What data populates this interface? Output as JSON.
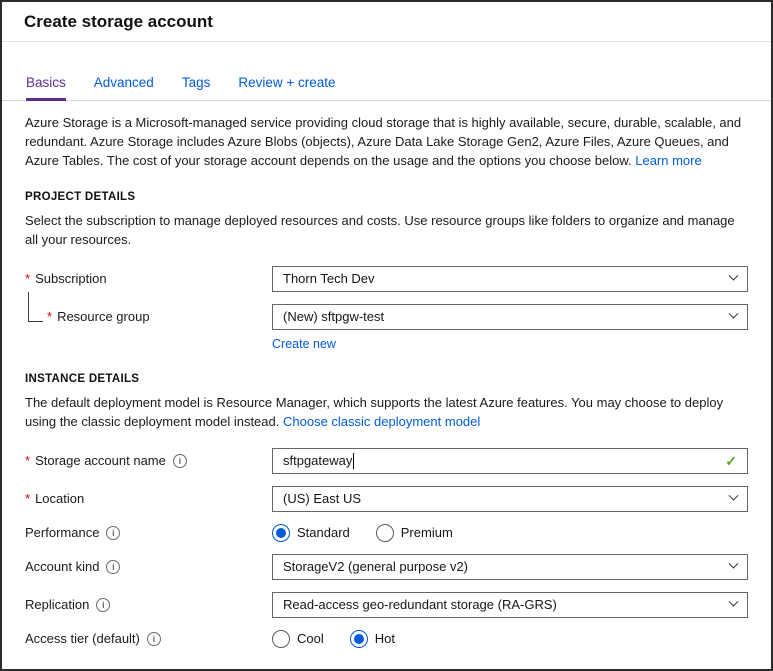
{
  "page": {
    "title": "Create storage account"
  },
  "tabs": [
    {
      "label": "Basics",
      "active": true
    },
    {
      "label": "Advanced",
      "active": false
    },
    {
      "label": "Tags",
      "active": false
    },
    {
      "label": "Review + create",
      "active": false
    }
  ],
  "intro": {
    "text": "Azure Storage is a Microsoft-managed service providing cloud storage that is highly available, secure, durable, scalable, and redundant. Azure Storage includes Azure Blobs (objects), Azure Data Lake Storage Gen2, Azure Files, Azure Queues, and Azure Tables. The cost of your storage account depends on the usage and the options you choose below.",
    "learn_more_label": "Learn more"
  },
  "project_details": {
    "heading": "PROJECT DETAILS",
    "description": "Select the subscription to manage deployed resources and costs. Use resource groups like folders to organize and manage all your resources.",
    "subscription": {
      "label": "Subscription",
      "required": true,
      "value": "Thorn Tech Dev"
    },
    "resource_group": {
      "label": "Resource group",
      "required": true,
      "value": "(New) sftpgw-test",
      "create_new_label": "Create new"
    }
  },
  "instance_details": {
    "heading": "INSTANCE DETAILS",
    "description": "The default deployment model is Resource Manager, which supports the latest Azure features. You may choose to deploy using the classic deployment model instead.",
    "classic_link_label": "Choose classic deployment model",
    "storage_account_name": {
      "label": "Storage account name",
      "required": true,
      "value": "sftpgateway",
      "valid": true
    },
    "location": {
      "label": "Location",
      "required": true,
      "value": "(US) East US"
    },
    "performance": {
      "label": "Performance",
      "options": [
        "Standard",
        "Premium"
      ],
      "selected": "Standard"
    },
    "account_kind": {
      "label": "Account kind",
      "value": "StorageV2 (general purpose v2)"
    },
    "replication": {
      "label": "Replication",
      "value": "Read-access geo-redundant storage (RA-GRS)"
    },
    "access_tier": {
      "label": "Access tier (default)",
      "options": [
        "Cool",
        "Hot"
      ],
      "selected": "Hot"
    }
  },
  "icons": {
    "required_marker": "*",
    "info_glyph": "i",
    "checkmark_glyph": "✓"
  },
  "colors": {
    "link_blue": "#015cda",
    "active_tab_purple": "#5c2d91",
    "required_red": "#dd0000",
    "radio_selected_blue": "#015cda",
    "valid_green": "#5aa52a"
  }
}
